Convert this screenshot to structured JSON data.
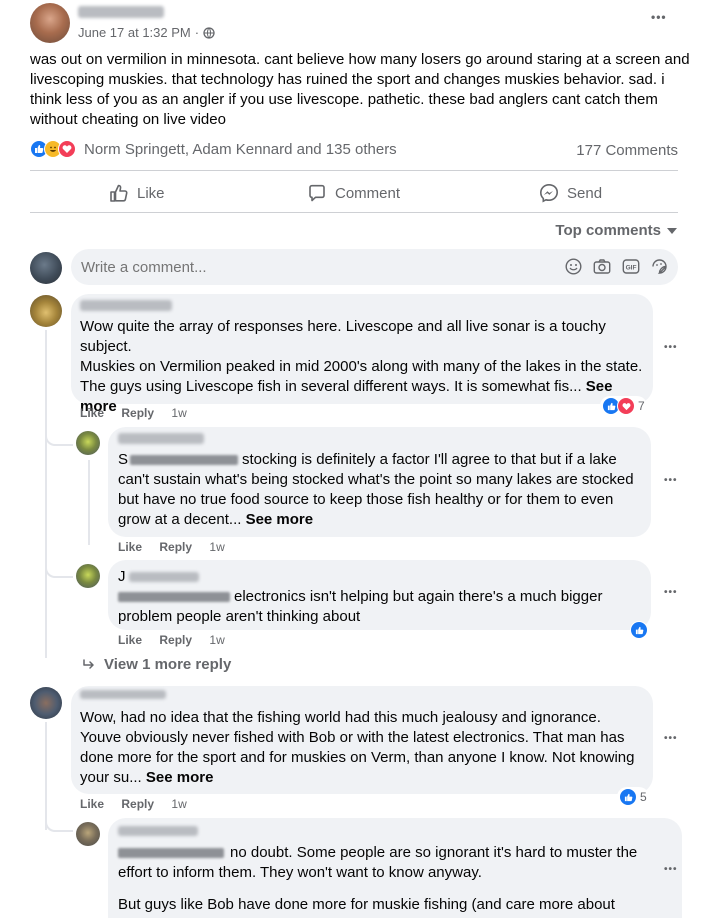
{
  "post": {
    "author_name": "",
    "timestamp": "June 17 at 1:32 PM",
    "privacy_sep": "·",
    "body": "was out on vermilion in minnesota. cant believe how many losers go around staring at a screen and livescoping muskies. that technology has ruined the sport and changes muskies behavior. sad. i think less of you as an angler if you use livescope. pathetic. these bad anglers cant catch them without cheating on live video",
    "reactions_text": "Norm Springett, Adam Kennard and 135 others",
    "comments_count": "177 Comments",
    "more_label": "•••"
  },
  "actions": {
    "like": "Like",
    "comment": "Comment",
    "send": "Send"
  },
  "sort": {
    "label": "Top comments"
  },
  "composer": {
    "placeholder": "Write a comment..."
  },
  "comments": [
    {
      "author_hidden": true,
      "lines": [
        "Wow quite the array of responses here. Livescope and all live sonar is a touchy",
        "subject.",
        "Muskies on Vermilion peaked in mid 2000's along with many of the lakes in the state.",
        "The guys using Livescope fish in several different ways. It is somewhat fis..."
      ],
      "see_more": "See more",
      "like": "Like",
      "reply": "Reply",
      "time": "1w",
      "reaction_count": "7",
      "replies": [
        {
          "prefix": "S",
          "lines": [
            "stocking is definitely a factor I'll agree to that but if a lake",
            "can't sustain what's being stocked what's the point so many lakes are stocked",
            "but have no true food source to keep those fish healthy or for them to even",
            "grow at a decent..."
          ],
          "see_more": "See more",
          "like": "Like",
          "reply": "Reply",
          "time": "1w"
        },
        {
          "prefix": "J",
          "lines": [
            "electronics isn't helping but again there's a much bigger",
            "problem people aren't thinking about"
          ],
          "like": "Like",
          "reply": "Reply",
          "time": "1w"
        }
      ],
      "view_more": "View 1 more reply"
    },
    {
      "lines": [
        "Wow, had no idea that the fishing world had this much jealousy and ignorance.",
        "Youve obviously never fished with Bob or with the latest electronics. That man has",
        "done more for the sport and for muskies on Verm, than anyone I know. Not knowing",
        "your su..."
      ],
      "see_more": "See more",
      "like": "Like",
      "reply": "Reply",
      "time": "1w",
      "reaction_count": "5",
      "replies": [
        {
          "lines": [
            "no doubt. Some people are so ignorant it's hard to muster the",
            "effort to inform them. They won't want to know anyway.",
            "But guys like Bob have done more for muskie fishing (and care more about"
          ]
        }
      ]
    }
  ],
  "colors": {
    "accent": "#1877f2",
    "muted": "#65676b",
    "bubble": "#f0f2f5",
    "love": "#f33e58",
    "haha": "#f7b928"
  }
}
